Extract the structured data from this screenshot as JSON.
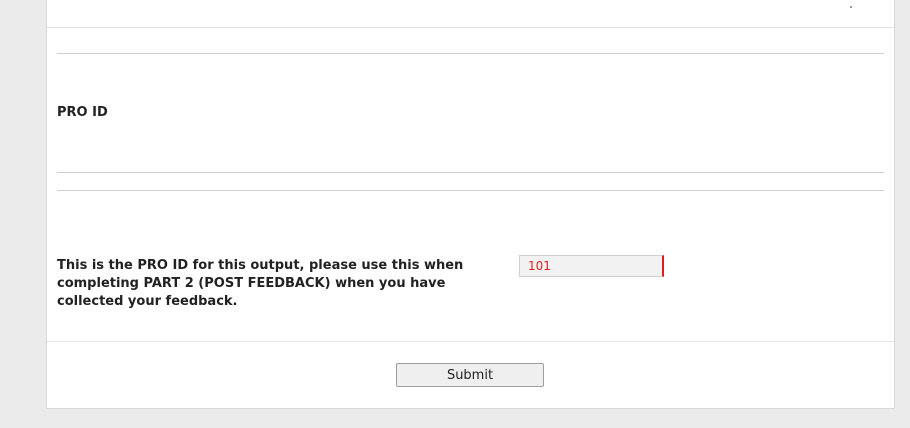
{
  "form": {
    "section_title": "PRO ID",
    "description": "This is the PRO ID for this output, please use this when completing PART 2 (POST FEEDBACK) when you have collected your feedback.",
    "pro_id_value": "101",
    "submit_label": "Submit"
  }
}
